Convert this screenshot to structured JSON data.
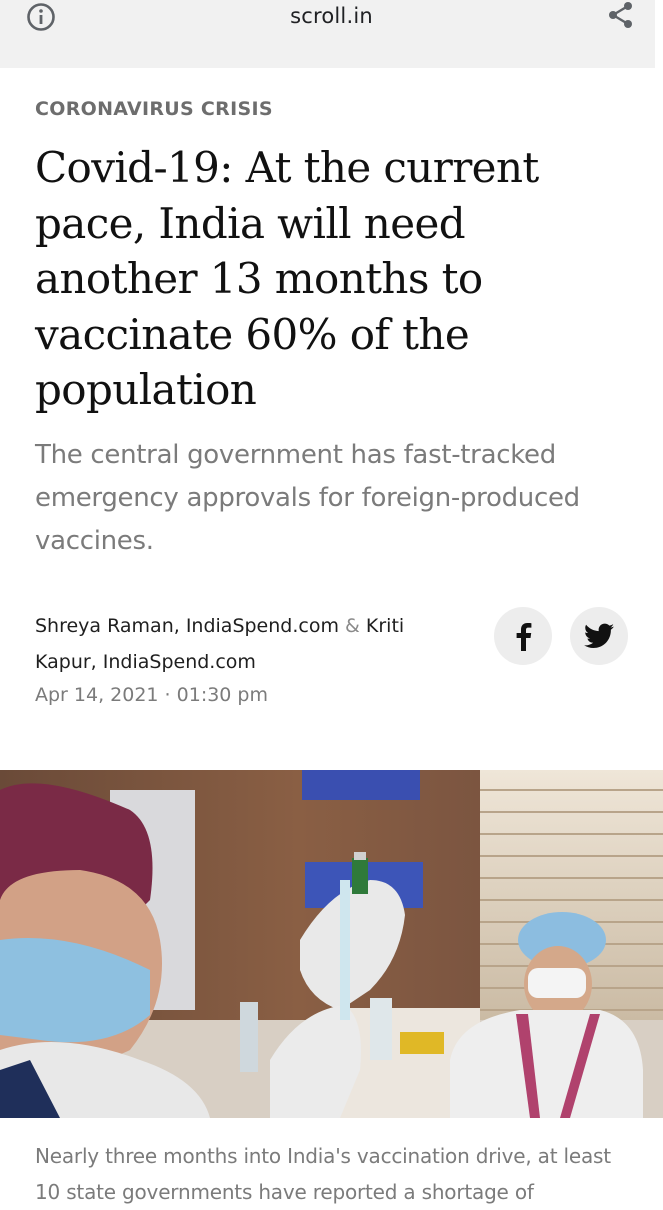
{
  "browser": {
    "domain": "scroll.in",
    "info_icon": "info-icon",
    "share_icon": "share-icon"
  },
  "article": {
    "section": "CORONAVIRUS CRISIS",
    "headline": "Covid-19: At the current pace, India will need another 13 months to vaccinate 60% of the population",
    "dek": "The central government has fast-tracked emergency approvals for foreign-produced vaccines.",
    "byline": {
      "author1": "Shreya Raman, IndiaSpend.com",
      "separator": "&",
      "author2": "Kriti Kapur, IndiaSpend.com"
    },
    "date": "Apr 14, 2021 · 01:30 pm",
    "caption": "Nearly three months into India's vaccination drive, at least 10 state governments have reported a shortage of"
  },
  "share": {
    "facebook_icon": "facebook-icon",
    "twitter_icon": "twitter-icon"
  },
  "colors": {
    "topbar_bg": "#f1f1f1",
    "headline": "#111111",
    "muted_text": "#7b7b7b",
    "social_button_bg": "#ededed"
  }
}
